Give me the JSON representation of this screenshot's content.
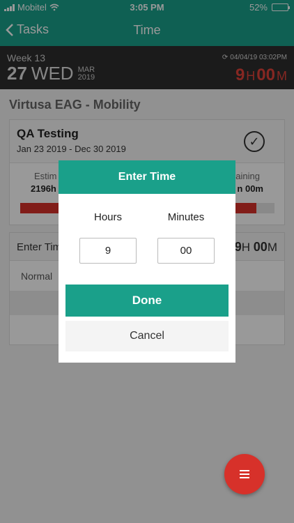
{
  "status_bar": {
    "carrier": "Mobitel",
    "time": "3:05 PM",
    "battery": "52%",
    "battery_level": 0.52
  },
  "nav": {
    "back_label": "Tasks",
    "title": "Time"
  },
  "date_header": {
    "week": "Week 13",
    "day_number": "27",
    "day_name": "WED",
    "month": "MAR",
    "year": "2019",
    "sync_time": "04/04/19 03:02PM",
    "total_hours_value": "9",
    "total_hours_unit": "H",
    "total_minutes_value": "00",
    "total_minutes_unit": "M"
  },
  "project": {
    "title": "Virtusa EAG - Mobility"
  },
  "task": {
    "name": "QA Testing",
    "dates": "Jan 23 2019 - Dec 30 2019",
    "estimate_label": "Estim",
    "estimate_value": "2196h",
    "remaining_label": "aining",
    "remaining_value": "n 00m",
    "progress": 0.93
  },
  "entry": {
    "label": "Enter Tim",
    "hours_value": "9",
    "hours_unit": "H",
    "minutes_value": "00",
    "minutes_unit": "M",
    "row_label": "Normal"
  },
  "dialog": {
    "title": "Enter Time",
    "hours_label": "Hours",
    "minutes_label": "Minutes",
    "hours_value": "9",
    "minutes_value": "00",
    "done_label": "Done",
    "cancel_label": "Cancel"
  },
  "fab": {
    "icon": "menu-icon"
  },
  "colors": {
    "primary": "#1aa08a",
    "accent": "#d7312a",
    "header_dark": "#2d2d2d"
  }
}
